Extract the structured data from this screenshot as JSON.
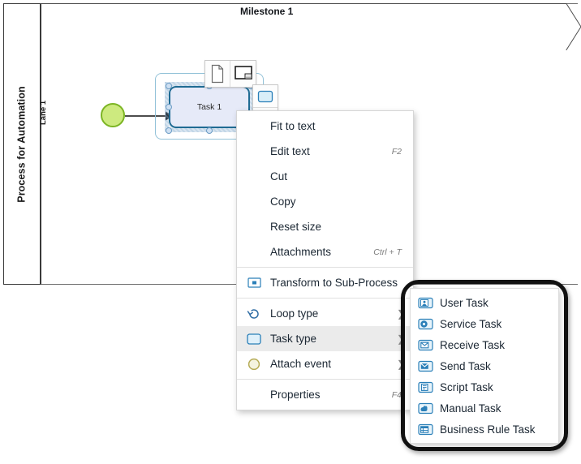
{
  "pool": {
    "title": "Process for Automation",
    "lane_label": "Lane 1",
    "milestone_label": "Milestone 1"
  },
  "shapes": {
    "start_event_name": "start-event",
    "task_label": "Task 1"
  },
  "mini_toolbar": {
    "buttons": [
      {
        "name": "attach-document-icon",
        "title": "Attach document"
      },
      {
        "name": "attach-screen-icon",
        "title": "Attach screen"
      }
    ],
    "vertical_buttons": [
      {
        "name": "task-type-icon",
        "title": "Task"
      }
    ]
  },
  "context_menu": {
    "items": [
      {
        "label": "Fit to text",
        "shortcut": "",
        "icon": "",
        "arrow": false,
        "highlighted": false,
        "separator_after": false
      },
      {
        "label": "Edit text",
        "shortcut": "F2",
        "icon": "",
        "arrow": false,
        "highlighted": false,
        "separator_after": false
      },
      {
        "label": "Cut",
        "shortcut": "",
        "icon": "",
        "arrow": false,
        "highlighted": false,
        "separator_after": false
      },
      {
        "label": "Copy",
        "shortcut": "",
        "icon": "",
        "arrow": false,
        "highlighted": false,
        "separator_after": false
      },
      {
        "label": "Reset size",
        "shortcut": "",
        "icon": "",
        "arrow": false,
        "highlighted": false,
        "separator_after": false
      },
      {
        "label": "Attachments",
        "shortcut": "Ctrl + T",
        "icon": "",
        "arrow": false,
        "highlighted": false,
        "separator_after": true
      },
      {
        "label": "Transform to Sub-Process",
        "shortcut": "",
        "icon": "sub-process-icon",
        "arrow": false,
        "highlighted": false,
        "separator_after": true
      },
      {
        "label": "Loop type",
        "shortcut": "",
        "icon": "loop-icon",
        "arrow": true,
        "highlighted": false,
        "separator_after": false
      },
      {
        "label": "Task type",
        "shortcut": "",
        "icon": "task-icon",
        "arrow": true,
        "highlighted": true,
        "separator_after": false
      },
      {
        "label": "Attach event",
        "shortcut": "",
        "icon": "event-circle-icon",
        "arrow": true,
        "highlighted": false,
        "separator_after": true
      },
      {
        "label": "Properties",
        "shortcut": "F4",
        "icon": "",
        "arrow": false,
        "highlighted": false,
        "separator_after": false
      }
    ]
  },
  "submenu": {
    "items": [
      {
        "label": "User Task",
        "icon": "user-task-icon"
      },
      {
        "label": "Service Task",
        "icon": "service-task-icon"
      },
      {
        "label": "Receive Task",
        "icon": "receive-task-icon"
      },
      {
        "label": "Send Task",
        "icon": "send-task-icon"
      },
      {
        "label": "Script Task",
        "icon": "script-task-icon"
      },
      {
        "label": "Manual Task",
        "icon": "manual-task-icon"
      },
      {
        "label": "Business Rule Task",
        "icon": "business-rule-task-icon"
      }
    ]
  },
  "colors": {
    "task_fill": "#e6eaf8",
    "task_border": "#1f6b93",
    "start_event_fill": "#cdea7f",
    "start_event_border": "#7cb524",
    "menu_highlight": "#ebebeb",
    "annotation_border": "#111111",
    "icon_blue": "#2a7fb8"
  }
}
